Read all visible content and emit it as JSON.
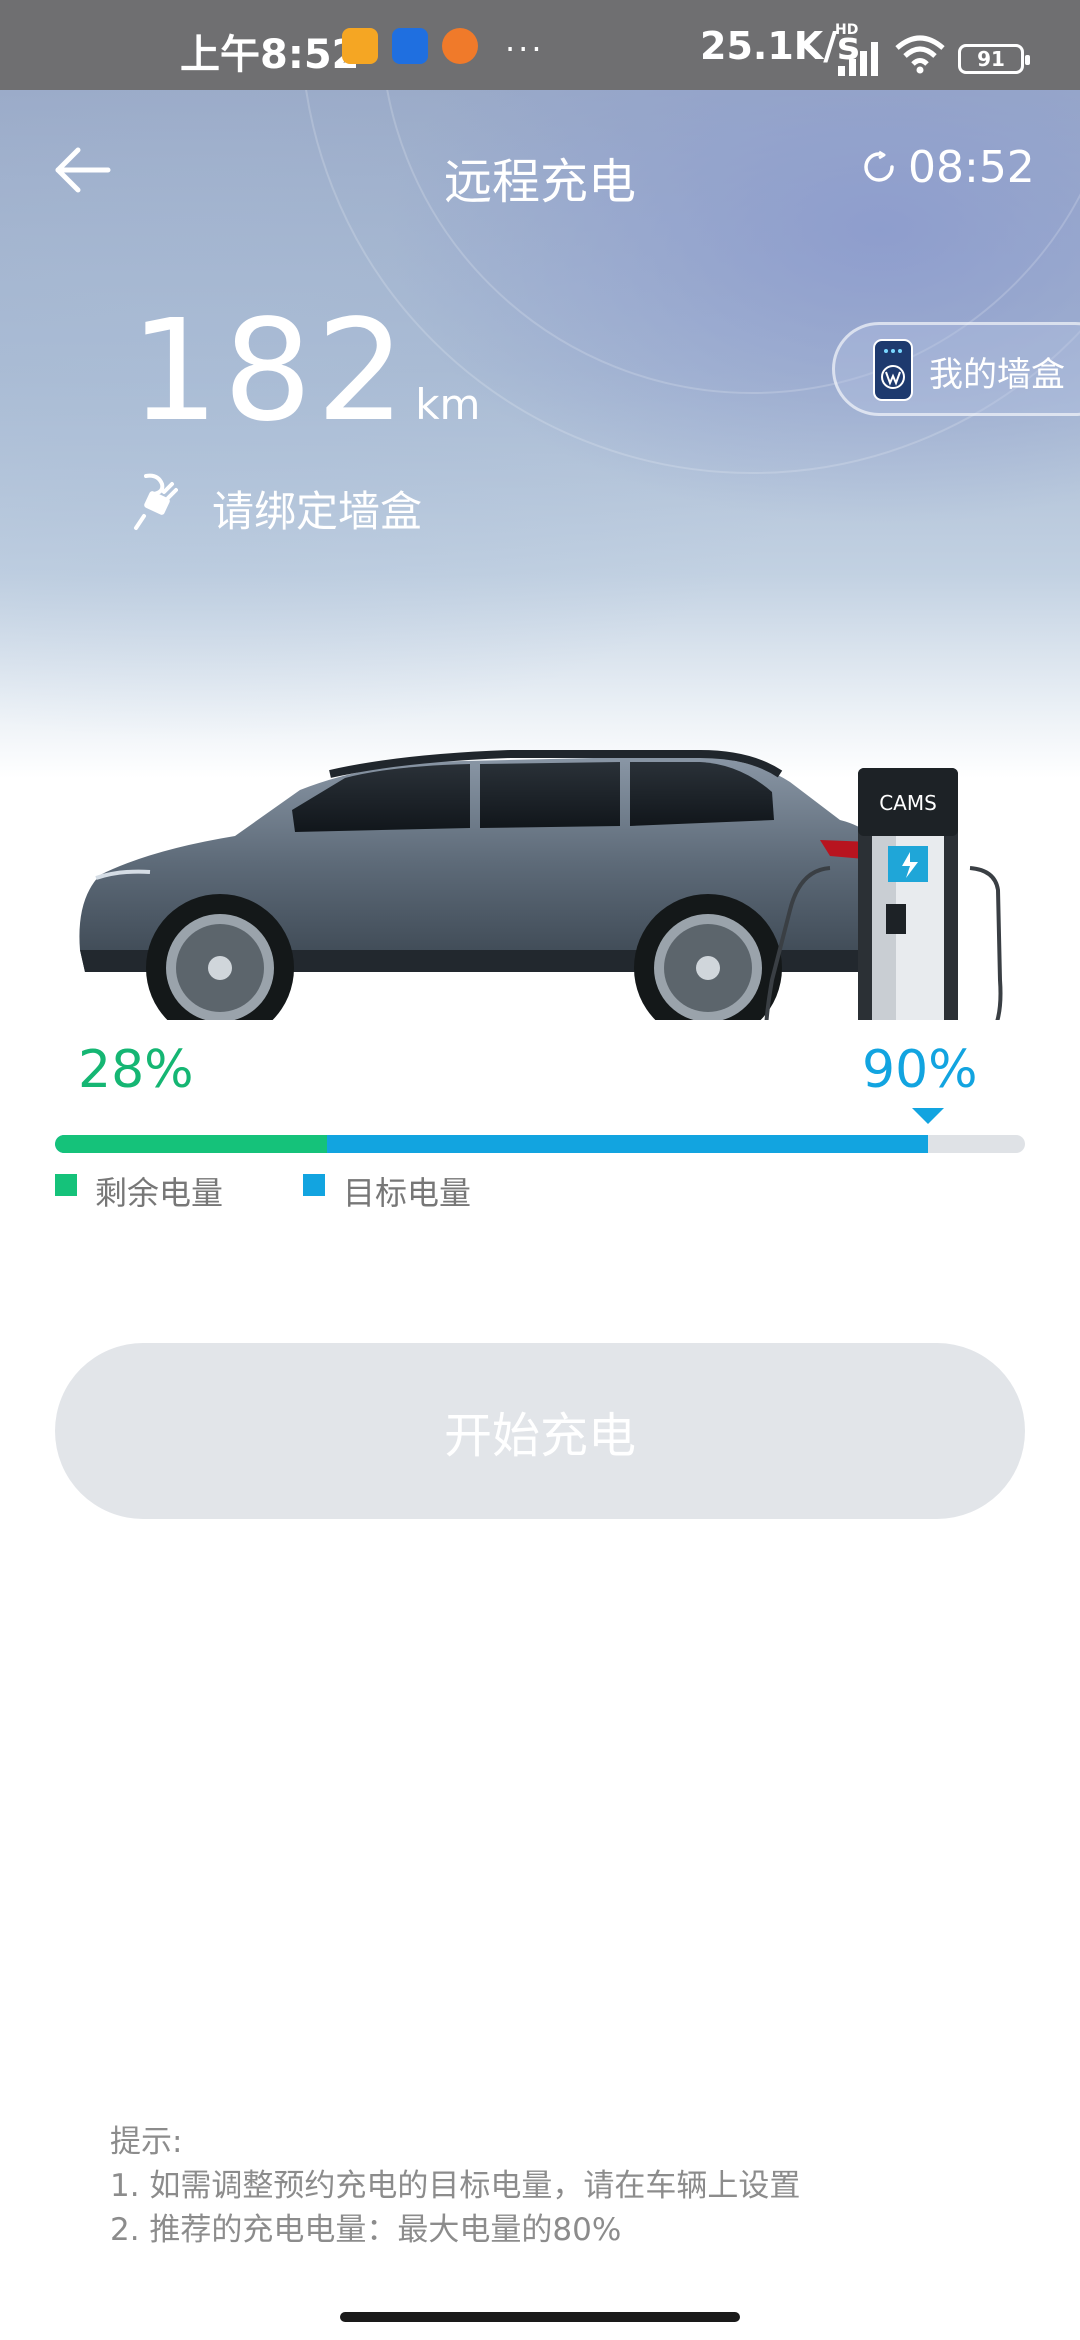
{
  "status_bar": {
    "time": "上午8:52",
    "network_speed": "25.1K/s",
    "network_type": "HD",
    "battery": "91",
    "more_indicator": "···"
  },
  "header": {
    "title": "远程充电",
    "timer": "08:52"
  },
  "vehicle": {
    "range_value": "182",
    "range_unit": "km",
    "wallbox_status": "请绑定墙盒"
  },
  "wallbox_button": {
    "label": "我的墙盒"
  },
  "charger": {
    "brand": "CAMS"
  },
  "charge_level": {
    "current_percent_label": "28%",
    "target_percent_label": "90%",
    "current_fraction": 0.28,
    "target_fraction": 0.9,
    "legend_current": "剩余电量",
    "legend_target": "目标电量",
    "colors": {
      "current": "#15c27a",
      "target": "#12a4e0",
      "track": "#dfe2e6"
    }
  },
  "actions": {
    "start_label": "开始充电"
  },
  "tips": {
    "heading": "提示:",
    "line1": "1. 如需调整预约充电的目标电量，请在车辆上设置",
    "line2": "2. 推荐的充电电量：最大电量的80%"
  },
  "icons": [
    "back-arrow-icon",
    "timer-icon",
    "plug-icon",
    "wallbox-icon"
  ]
}
